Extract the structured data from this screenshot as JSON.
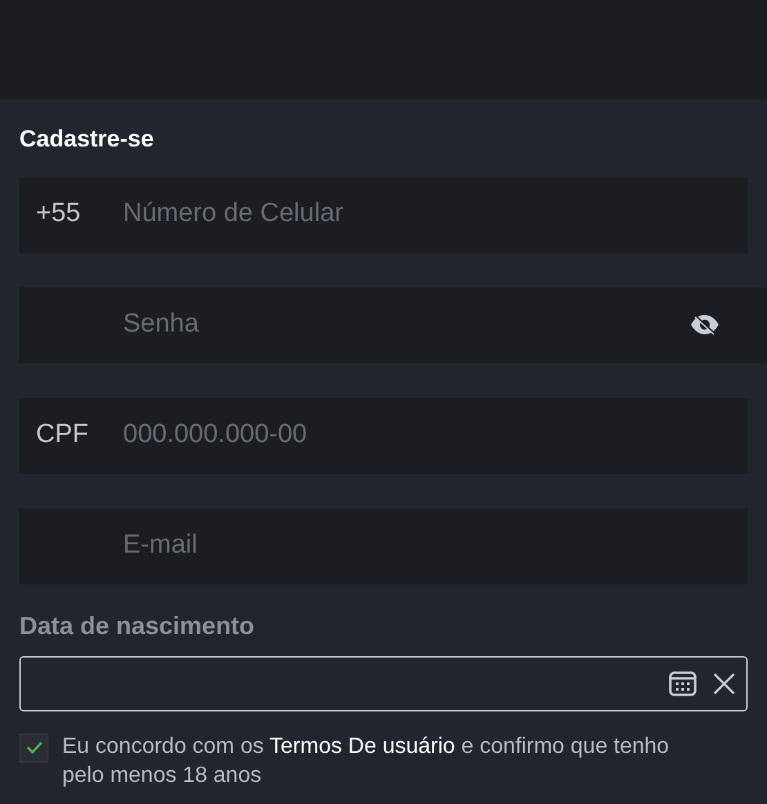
{
  "form": {
    "title": "Cadastre-se",
    "fields": [
      {
        "kind": "text",
        "prefix": "+55",
        "placeholder": "Número de Celular"
      },
      {
        "kind": "password",
        "placeholder": "Senha"
      },
      {
        "kind": "text",
        "prefix": "CPF",
        "placeholder": "000.000.000-00"
      },
      {
        "kind": "text",
        "placeholder": "E-mail"
      }
    ],
    "birth_date": {
      "label": "Data de nascimento"
    },
    "terms": {
      "checked": true,
      "text_before": "Eu concordo com os",
      "link": "Termos De usuário",
      "text_after": "e confirmo que tenho pelo menos 18 anos"
    }
  }
}
